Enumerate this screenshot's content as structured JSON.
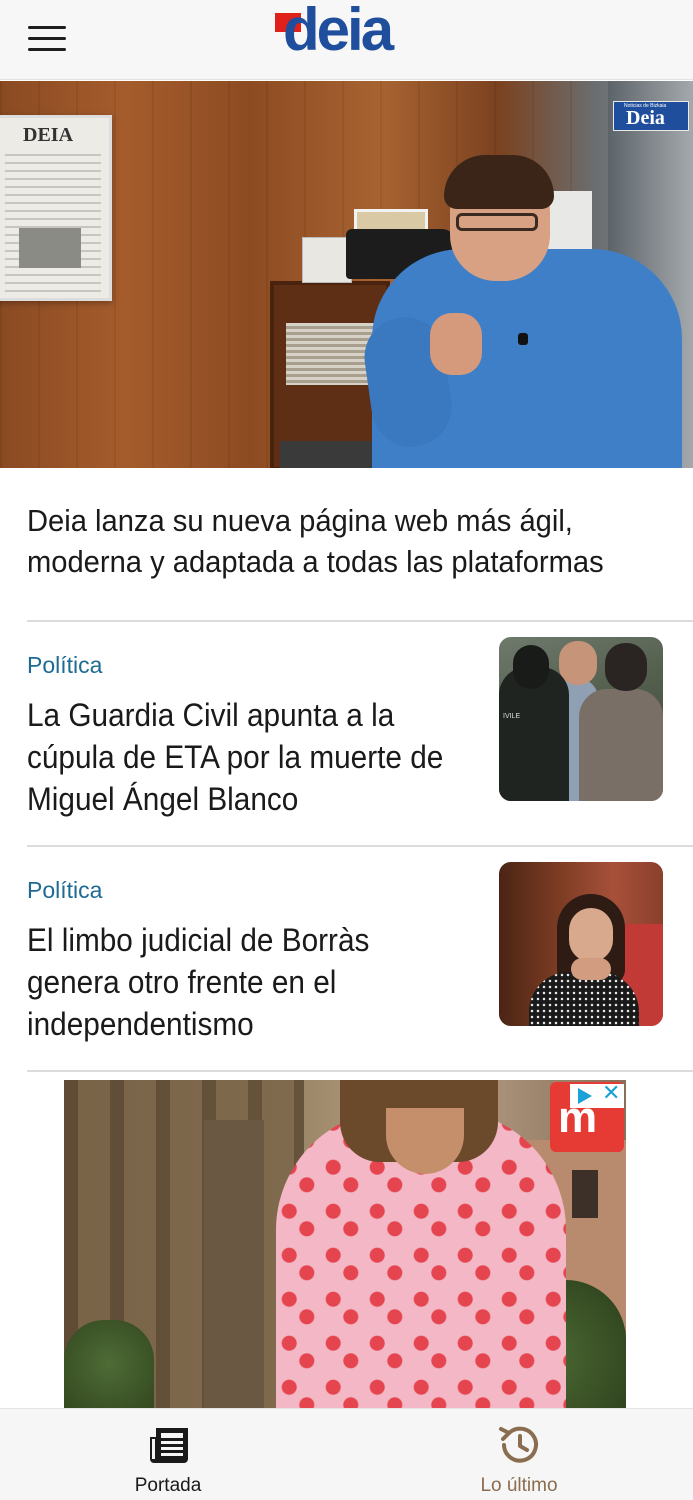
{
  "header": {
    "logo_text": "deia",
    "menu_icon": "hamburger-menu-icon"
  },
  "hero": {
    "badge_small": "Noticias de Bizkaia",
    "badge_main": "Deia",
    "newspaper_title": "DEIA",
    "title": "Deia lanza su nueva página web más ágil, moderna y adaptada a todas las plataformas"
  },
  "articles": [
    {
      "category": "Política",
      "title": "La Guardia Civil apunta a la cúpula de ETA por la muerte de Miguel Ángel Blanco",
      "thumb_text": "IVILE"
    },
    {
      "category": "Política",
      "title": "El limbo judicial de Borràs genera otro frente en el independentismo"
    }
  ],
  "ad": {
    "brand_text": "m",
    "adchoices_icon": "adchoices-play-icon",
    "close_symbol": "✕"
  },
  "bottom_nav": {
    "items": [
      {
        "label": "Portada",
        "icon": "newspaper-icon",
        "active": true
      },
      {
        "label": "Lo último",
        "icon": "history-clock-icon",
        "active": false
      }
    ]
  },
  "colors": {
    "brand_blue": "#1f4e9d",
    "brand_red": "#e0211b",
    "category_blue": "#1d6a94",
    "inactive_nav": "#8a6c4e"
  }
}
